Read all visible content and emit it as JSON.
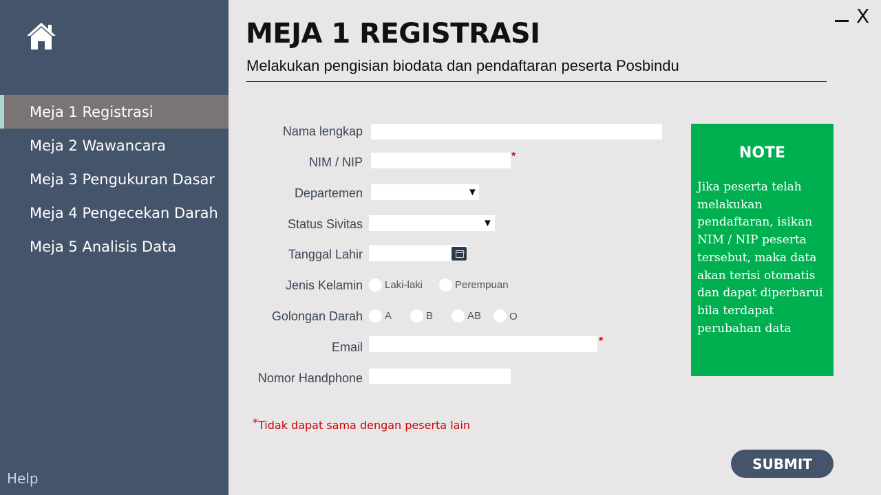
{
  "window": {
    "minimize_icon": "minimize-icon",
    "close_glyph": "X"
  },
  "sidebar": {
    "home_icon": "home-icon",
    "items": [
      {
        "label": "Meja 1 Registrasi",
        "active": true
      },
      {
        "label": "Meja 2 Wawancara",
        "active": false
      },
      {
        "label": "Meja 3 Pengukuran Dasar",
        "active": false
      },
      {
        "label": "Meja 4 Pengecekan Darah",
        "active": false
      },
      {
        "label": "Meja 5 Analisis Data",
        "active": false
      }
    ],
    "help_label": "Help"
  },
  "header": {
    "title": "MEJA 1 REGISTRASI",
    "subtitle": "Melakukan pengisian biodata dan pendaftaran peserta Posbindu"
  },
  "form": {
    "nama_label": "Nama lengkap",
    "nama_value": "",
    "nim_label": "NIM / NIP",
    "nim_value": "",
    "departemen_label": "Departemen",
    "departemen_value": "",
    "status_label": "Status Sivitas",
    "status_value": "",
    "tanggal_label": "Tanggal Lahir",
    "tanggal_value": "",
    "jenis_label": "Jenis Kelamin",
    "jenis_options": [
      "Laki-laki",
      "Perempuan"
    ],
    "golongan_label": "Golongan Darah",
    "golongan_options": [
      "A",
      "B",
      "AB",
      "O"
    ],
    "email_label": "Email",
    "email_value": "",
    "hp_label": "Nomor Handphone",
    "hp_value": "",
    "required_mark": "*",
    "footnote": "Tidak dapat sama dengan peserta lain"
  },
  "note": {
    "title": "NOTE",
    "text": "Jika peserta telah melakukan pendaftaran, isikan NIM / NIP peserta tersebut, maka data akan terisi otomatis dan dapat diperbarui bila terdapat perubahan data"
  },
  "submit_label": "SUBMIT",
  "colors": {
    "sidebar": "#44546a",
    "active_item": "#7b7474",
    "note_bg": "#00b050",
    "required": "#e00000"
  }
}
